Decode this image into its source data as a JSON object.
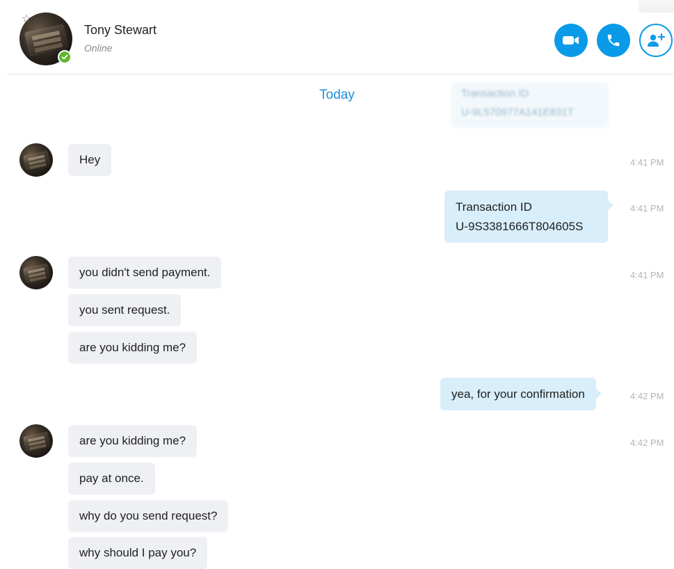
{
  "contact": {
    "name": "Tony Stewart",
    "status": "Online"
  },
  "header_actions": {
    "video_icon": "video-camera-icon",
    "call_icon": "phone-icon",
    "add_icon": "add-person-icon"
  },
  "colors": {
    "accent": "#0a9be8",
    "online": "#5fb62e",
    "incoming_bubble": "#eef0f4",
    "outgoing_bubble": "#d8eefa",
    "date_separator": "#1d8fd6"
  },
  "chat": {
    "date_separator": "Today",
    "ghost": {
      "line1": "Transaction ID",
      "line2": "U-9L570977A141E831T"
    },
    "messages": [
      {
        "text": "Hey",
        "time": "4:41 PM"
      },
      {
        "line1": "Transaction ID",
        "line2": "U-9S3381666T804605S",
        "time": "4:41 PM"
      },
      {
        "text": "you didn't send payment.",
        "time": "4:41 PM"
      },
      {
        "text": "you sent request."
      },
      {
        "text": "are you kidding me?"
      },
      {
        "text": "yea, for your confirmation",
        "time": "4:42 PM"
      },
      {
        "text": "are you kidding me?",
        "time": "4:42 PM"
      },
      {
        "text": "pay at once."
      },
      {
        "text": "why do you send request?"
      },
      {
        "text": "why should I pay you?"
      }
    ]
  }
}
